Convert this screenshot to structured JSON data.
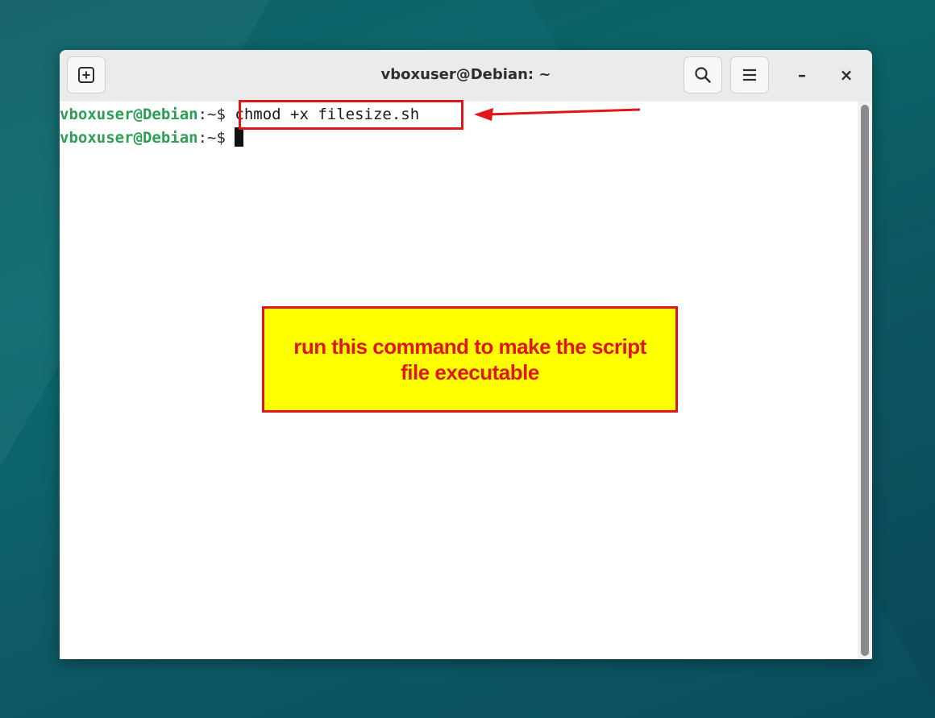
{
  "window": {
    "title": "vboxuser@Debian: ~"
  },
  "toolbar": {
    "new_tab_icon": "plus-square-icon",
    "search_icon": "search-icon",
    "menu_icon": "hamburger-menu-icon",
    "minimize_label": "–",
    "close_label": "×"
  },
  "terminal": {
    "lines": [
      {
        "user": "vboxuser@Debian",
        "path": ":~$",
        "command": "chmod +x filesize.sh"
      },
      {
        "user": "vboxuser@Debian",
        "path": ":~$",
        "command": ""
      }
    ]
  },
  "annotation": {
    "callout_text": "run this command to make the script file executable",
    "color": "#e0161b",
    "callout_background": "#ffff00"
  },
  "colors": {
    "prompt_user": "#2e9e55"
  }
}
